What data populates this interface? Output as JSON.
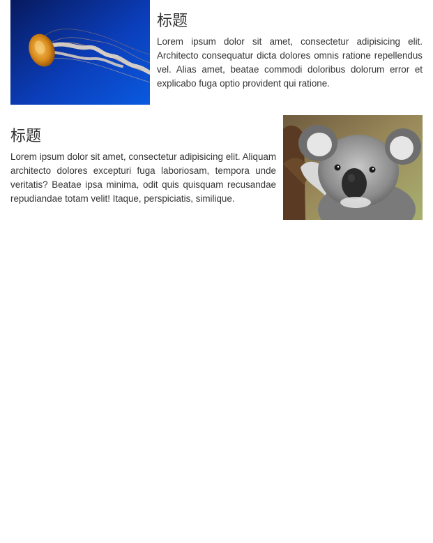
{
  "media_items": [
    {
      "heading": "标题",
      "text": "Lorem ipsum dolor sit amet, consectetur adipisicing elit. Architecto consequatur dicta dolores omnis ratione repellendus vel. Alias amet, beatae commodi doloribus dolorum error et explicabo fuga optio provident qui ratione.",
      "image_subject": "jellyfish",
      "image_side": "left"
    },
    {
      "heading": "标题",
      "text": "Lorem ipsum dolor sit amet, consectetur adipisicing elit. Aliquam architecto dolores excepturi fuga laboriosam, tempora unde veritatis? Beatae ipsa minima, odit quis quisquam recusandae repudiandae totam velit! Itaque, perspiciatis, similique.",
      "image_subject": "koala",
      "image_side": "right"
    }
  ],
  "colors": {
    "text": "#333333",
    "background": "#ffffff",
    "jellyfish_bg": "#0a2a8a",
    "koala_fur": "#8a8a8a"
  }
}
